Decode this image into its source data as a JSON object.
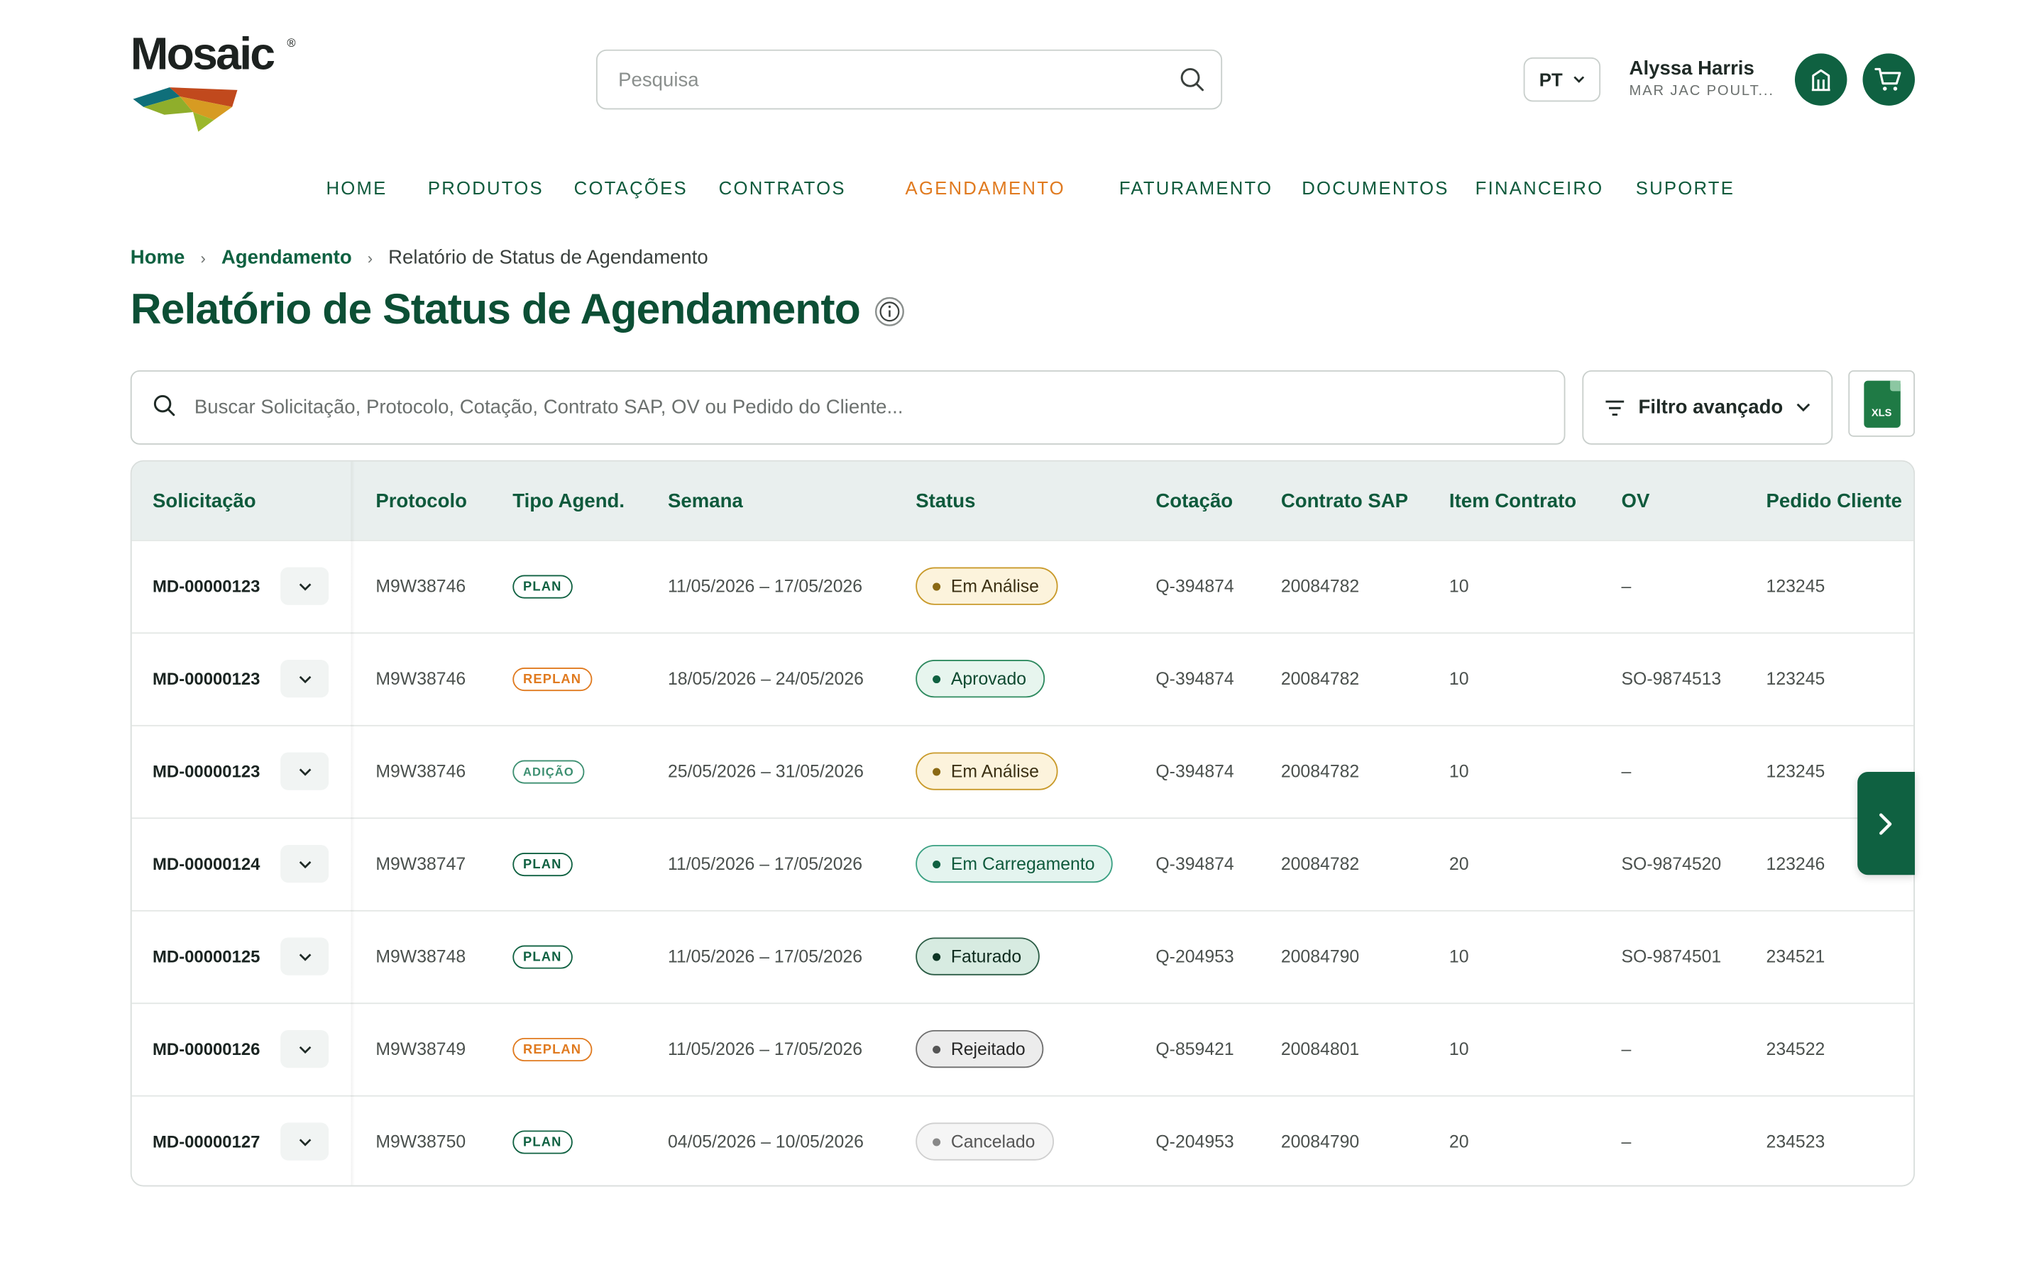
{
  "brand": {
    "name": "Mosaic",
    "reg": "®",
    "accent": "#0f6141",
    "active_color": "#e07a1f"
  },
  "header": {
    "search_placeholder": "Pesquisa",
    "language": "PT",
    "user_name": "Alyssa Harris",
    "user_company": "MAR JAC POULT..."
  },
  "nav": [
    "HOME",
    "PRODUTOS",
    "COTAÇÕES",
    "CONTRATOS",
    "AGENDAMENTO",
    "FATURAMENTO",
    "DOCUMENTOS",
    "FINANCEIRO",
    "SUPORTE"
  ],
  "nav_active": "AGENDAMENTO",
  "breadcrumb": {
    "home": "Home",
    "section": "Agendamento",
    "current": "Relatório de Status de Agendamento",
    "separator": "›"
  },
  "page_title": "Relatório de Status de Agendamento",
  "filters": {
    "search_placeholder": "Buscar Solicitação, Protocolo, Cotação, Contrato SAP, OV ou Pedido do Cliente...",
    "advanced_label": "Filtro avançado",
    "export_label": "XLS"
  },
  "table": {
    "columns": [
      "Solicitação",
      "Protocolo",
      "Tipo Agend.",
      "Semana",
      "Status",
      "Cotação",
      "Contrato SAP",
      "Item Contrato",
      "OV",
      "Pedido Cliente"
    ],
    "rows": [
      {
        "solicitacao": "MD-00000123",
        "protocolo": "M9W38746",
        "tipo": "PLAN",
        "semana": "11/05/2026 – 17/05/2026",
        "status": "Em Análise",
        "cotacao": "Q-394874",
        "contrato": "20084782",
        "item": "10",
        "ov": "–",
        "pedido": "123245"
      },
      {
        "solicitacao": "MD-00000123",
        "protocolo": "M9W38746",
        "tipo": "REPLAN",
        "semana": "18/05/2026 – 24/05/2026",
        "status": "Aprovado",
        "cotacao": "Q-394874",
        "contrato": "20084782",
        "item": "10",
        "ov": "SO-9874513",
        "pedido": "123245"
      },
      {
        "solicitacao": "MD-00000123",
        "protocolo": "M9W38746",
        "tipo": "ADIÇÃO",
        "semana": "25/05/2026 – 31/05/2026",
        "status": "Em Análise",
        "cotacao": "Q-394874",
        "contrato": "20084782",
        "item": "10",
        "ov": "–",
        "pedido": "123245"
      },
      {
        "solicitacao": "MD-00000124",
        "protocolo": "M9W38747",
        "tipo": "PLAN",
        "semana": "11/05/2026 – 17/05/2026",
        "status": "Em Carregamento",
        "cotacao": "Q-394874",
        "contrato": "20084782",
        "item": "20",
        "ov": "SO-9874520",
        "pedido": "123246"
      },
      {
        "solicitacao": "MD-00000125",
        "protocolo": "M9W38748",
        "tipo": "PLAN",
        "semana": "11/05/2026 – 17/05/2026",
        "status": "Faturado",
        "cotacao": "Q-204953",
        "contrato": "20084790",
        "item": "10",
        "ov": "SO-9874501",
        "pedido": "234521"
      },
      {
        "solicitacao": "MD-00000126",
        "protocolo": "M9W38749",
        "tipo": "REPLAN",
        "semana": "11/05/2026 – 17/05/2026",
        "status": "Rejeitado",
        "cotacao": "Q-859421",
        "contrato": "20084801",
        "item": "10",
        "ov": "–",
        "pedido": "234522"
      },
      {
        "solicitacao": "MD-00000127",
        "protocolo": "M9W38750",
        "tipo": "PLAN",
        "semana": "04/05/2026 – 10/05/2026",
        "status": "Cancelado",
        "cotacao": "Q-204953",
        "contrato": "20084790",
        "item": "20",
        "ov": "–",
        "pedido": "234523"
      }
    ]
  },
  "icons": {
    "search": "search-icon",
    "chevron": "chevron-down-icon",
    "bank": "building-icon",
    "cart": "cart-icon",
    "info": "info-icon",
    "filter": "filter-lines-icon",
    "excel": "excel-file-icon",
    "next": "chevron-right-icon"
  }
}
